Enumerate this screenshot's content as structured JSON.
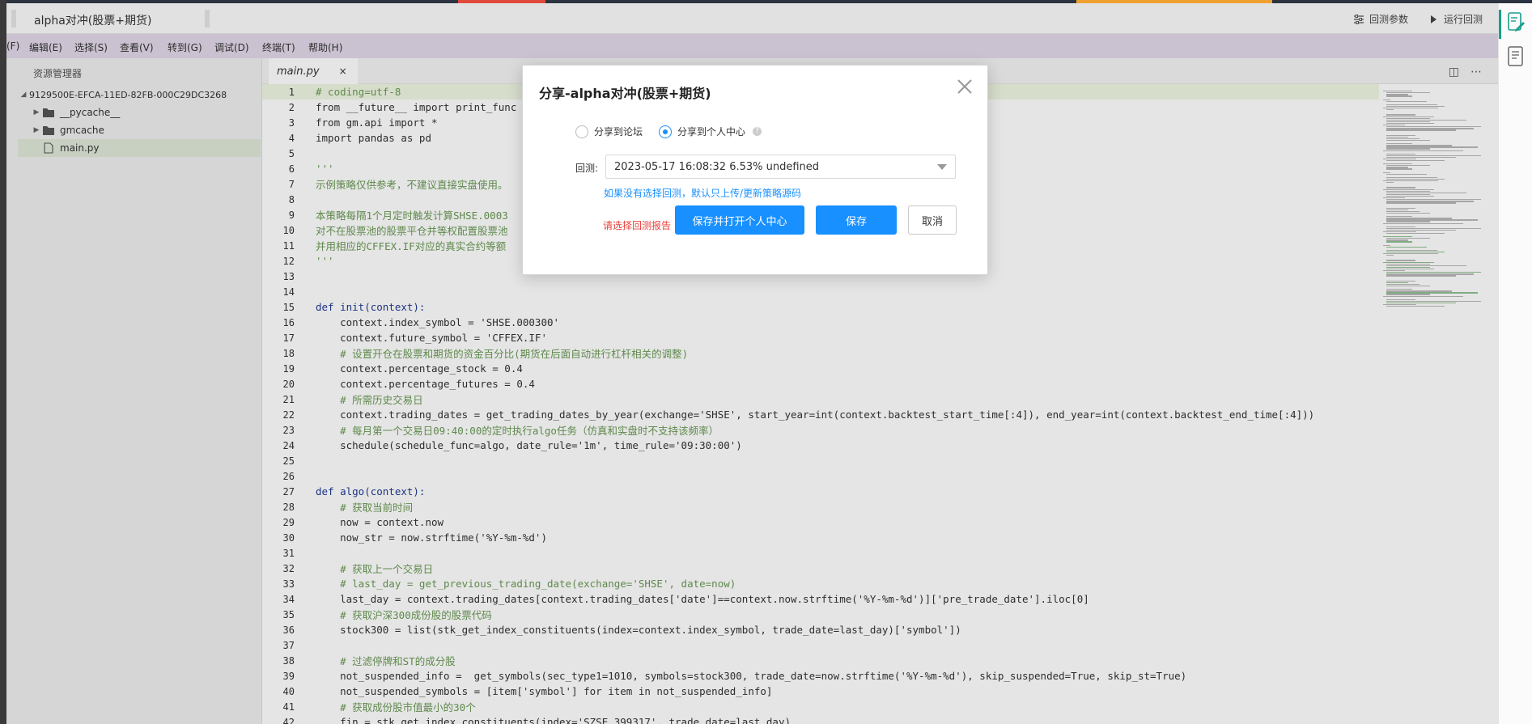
{
  "window": {
    "title": "alpha对冲(股票+期货)",
    "actions": {
      "params": "回测参数",
      "run": "运行回测"
    }
  },
  "menu": {
    "items": [
      "(F)",
      "编辑(E)",
      "选择(S)",
      "查看(V)",
      "转到(G)",
      "调试(D)",
      "终端(T)",
      "帮助(H)"
    ]
  },
  "explorer": {
    "header": "资源管理器",
    "root": "9129500E-EFCA-11ED-82FB-000C29DC3268",
    "items": [
      {
        "name": "__pycache__",
        "type": "folder"
      },
      {
        "name": "gmcache",
        "type": "folder"
      },
      {
        "name": "main.py",
        "type": "file",
        "selected": true
      }
    ]
  },
  "editor": {
    "tab": {
      "filename": "main.py",
      "close": "×"
    },
    "lines": [
      {
        "n": "1",
        "t": "# coding=utf-8"
      },
      {
        "n": "2",
        "t": "from __future__ import print_func"
      },
      {
        "n": "3",
        "t": "from gm.api import *"
      },
      {
        "n": "4",
        "t": "import pandas as pd"
      },
      {
        "n": "5",
        "t": ""
      },
      {
        "n": "6",
        "t": "'''"
      },
      {
        "n": "7",
        "t": "示例策略仅供参考，不建议直接实盘使用。"
      },
      {
        "n": "8",
        "t": ""
      },
      {
        "n": "9",
        "t": "本策略每隔1个月定时触发计算SHSE.0003"
      },
      {
        "n": "10",
        "t": "对不在股票池的股票平仓并等权配置股票池"
      },
      {
        "n": "11",
        "t": "并用相应的CFFEX.IF对应的真实合约等额"
      },
      {
        "n": "12",
        "t": "'''"
      },
      {
        "n": "13",
        "t": ""
      },
      {
        "n": "14",
        "t": ""
      },
      {
        "n": "15",
        "t": "def init(context):"
      },
      {
        "n": "16",
        "t": "    context.index_symbol = 'SHSE.000300'"
      },
      {
        "n": "17",
        "t": "    context.future_symbol = 'CFFEX.IF'"
      },
      {
        "n": "18",
        "t": "    # 设置开仓在股票和期货的资金百分比(期货在后面自动进行杠杆相关的调整)"
      },
      {
        "n": "19",
        "t": "    context.percentage_stock = 0.4"
      },
      {
        "n": "20",
        "t": "    context.percentage_futures = 0.4"
      },
      {
        "n": "21",
        "t": "    # 所需历史交易日"
      },
      {
        "n": "22",
        "t": "    context.trading_dates = get_trading_dates_by_year(exchange='SHSE', start_year=int(context.backtest_start_time[:4]), end_year=int(context.backtest_end_time[:4]))"
      },
      {
        "n": "23",
        "t": "    # 每月第一个交易日09:40:00的定时执行algo任务（仿真和实盘时不支持该频率）"
      },
      {
        "n": "24",
        "t": "    schedule(schedule_func=algo, date_rule='1m', time_rule='09:30:00')"
      },
      {
        "n": "25",
        "t": ""
      },
      {
        "n": "26",
        "t": ""
      },
      {
        "n": "27",
        "t": "def algo(context):"
      },
      {
        "n": "28",
        "t": "    # 获取当前时间"
      },
      {
        "n": "29",
        "t": "    now = context.now"
      },
      {
        "n": "30",
        "t": "    now_str = now.strftime('%Y-%m-%d')"
      },
      {
        "n": "31",
        "t": ""
      },
      {
        "n": "32",
        "t": "    # 获取上一个交易日"
      },
      {
        "n": "33",
        "t": "    # last_day = get_previous_trading_date(exchange='SHSE', date=now)"
      },
      {
        "n": "34",
        "t": "    last_day = context.trading_dates[context.trading_dates['date']==context.now.strftime('%Y-%m-%d')]['pre_trade_date'].iloc[0]"
      },
      {
        "n": "35",
        "t": "    # 获取沪深300成份股的股票代码"
      },
      {
        "n": "36",
        "t": "    stock300 = list(stk_get_index_constituents(index=context.index_symbol, trade_date=last_day)['symbol'])"
      },
      {
        "n": "37",
        "t": ""
      },
      {
        "n": "38",
        "t": "    # 过滤停牌和ST的成分股"
      },
      {
        "n": "39",
        "t": "    not_suspended_info =  get_symbols(sec_type1=1010, symbols=stock300, trade_date=now.strftime('%Y-%m-%d'), skip_suspended=True, skip_st=True)"
      },
      {
        "n": "40",
        "t": "    not_suspended_symbols = [item['symbol'] for item in not_suspended_info]"
      },
      {
        "n": "41",
        "t": "    # 获取成份股市值最小的30个"
      },
      {
        "n": "42",
        "t": "    fin = stk_get_index_constituents(index='SZSE.399317', trade_date=last_day)"
      }
    ]
  },
  "dialog": {
    "title": "分享-alpha对冲(股票+期货)",
    "radio_forum": "分享到论坛",
    "radio_personal": "分享到个人中心",
    "help": "?",
    "backtest_label": "回测:",
    "backtest_value": "2023-05-17 16:08:32  6.53%  undefined",
    "hint": "如果没有选择回测，默认只上传/更新策略源码",
    "error": "请选择回测报告",
    "btn_save_open": "保存并打开个人中心",
    "btn_save": "保存",
    "btn_cancel": "取消"
  },
  "colors": {
    "accent": "#1890ff",
    "error": "#e8403a",
    "menubar": "#e1d8e9",
    "comment": "#6a9955"
  }
}
